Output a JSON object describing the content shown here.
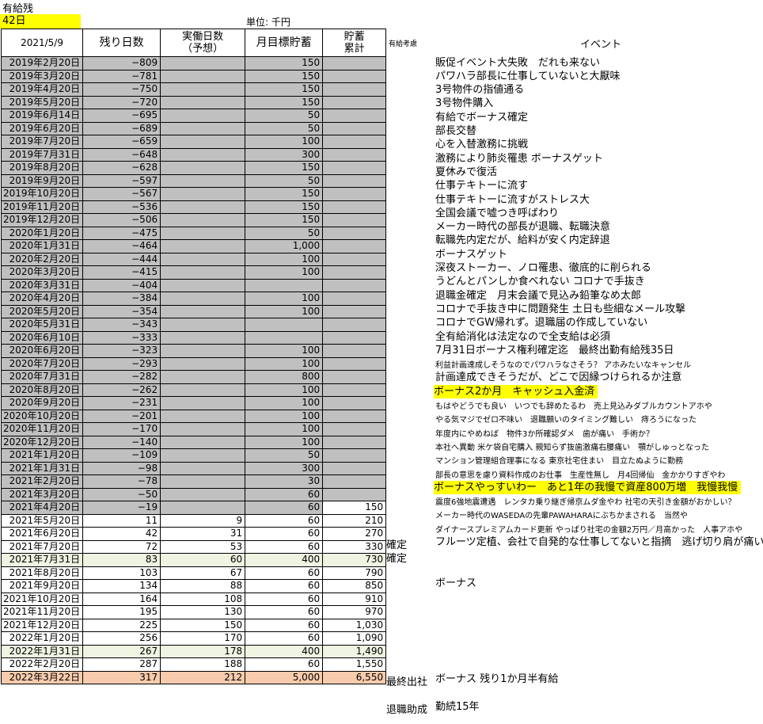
{
  "title": "有給残",
  "remaining_days": "42日",
  "unit_label": "単位: 千円",
  "headers": {
    "date": "2021/5/9",
    "remaining": "残り日数",
    "workdays": "実働日数\n（予想）",
    "target": "月目標貯蓄",
    "cumulative": "貯蓄\n累計",
    "notes": "有給考慮",
    "event": "イベント"
  },
  "rows": [
    {
      "date": "2019年2月20日",
      "remaining": "−809",
      "workdays": "",
      "target": "150",
      "cumulative": "",
      "note": "",
      "event": "販促イベント大失敗　だれも来ない",
      "style": "past",
      "small": false
    },
    {
      "date": "2019年3月20日",
      "remaining": "−781",
      "workdays": "",
      "target": "150",
      "cumulative": "",
      "note": "",
      "event": "パワハラ部長に仕事していないと大厭味",
      "style": "past",
      "small": false
    },
    {
      "date": "2019年4月20日",
      "remaining": "−750",
      "workdays": "",
      "target": "150",
      "cumulative": "",
      "note": "",
      "event": "3号物件の指値通る",
      "style": "past",
      "small": false
    },
    {
      "date": "2019年5月20日",
      "remaining": "−720",
      "workdays": "",
      "target": "150",
      "cumulative": "",
      "note": "",
      "event": "3号物件購入",
      "style": "past",
      "small": false
    },
    {
      "date": "2019年6月14日",
      "remaining": "−695",
      "workdays": "",
      "target": "50",
      "cumulative": "",
      "note": "",
      "event": "有給でボーナス確定",
      "style": "past",
      "small": false
    },
    {
      "date": "2019年6月20日",
      "remaining": "−689",
      "workdays": "",
      "target": "50",
      "cumulative": "",
      "note": "",
      "event": "部長交替",
      "style": "past",
      "small": false
    },
    {
      "date": "2019年7月20日",
      "remaining": "−659",
      "workdays": "",
      "target": "100",
      "cumulative": "",
      "note": "",
      "event": "心を入替激務に挑戦",
      "style": "past",
      "small": false
    },
    {
      "date": "2019年7月31日",
      "remaining": "−648",
      "workdays": "",
      "target": "300",
      "cumulative": "",
      "note": "",
      "event": "激務により肺炎罹患 ボーナスゲット",
      "style": "past",
      "small": false
    },
    {
      "date": "2019年8月20日",
      "remaining": "−628",
      "workdays": "",
      "target": "150",
      "cumulative": "",
      "note": "",
      "event": "夏休みで復活",
      "style": "past",
      "small": false
    },
    {
      "date": "2019年9月20日",
      "remaining": "−597",
      "workdays": "",
      "target": "50",
      "cumulative": "",
      "note": "",
      "event": "仕事テキトーに流す",
      "style": "past",
      "small": false
    },
    {
      "date": "2019年10月20日",
      "remaining": "−567",
      "workdays": "",
      "target": "150",
      "cumulative": "",
      "note": "",
      "event": "仕事テキトーに流すがストレス大",
      "style": "past",
      "small": false
    },
    {
      "date": "2019年11月20日",
      "remaining": "−536",
      "workdays": "",
      "target": "150",
      "cumulative": "",
      "note": "",
      "event": "全国会議で嘘つき呼ばわり",
      "style": "past",
      "small": false
    },
    {
      "date": "2019年12月20日",
      "remaining": "−506",
      "workdays": "",
      "target": "150",
      "cumulative": "",
      "note": "",
      "event": "メーカー時代の部長が退職、転職決意",
      "style": "past",
      "small": false
    },
    {
      "date": "2020年1月20日",
      "remaining": "−475",
      "workdays": "",
      "target": "50",
      "cumulative": "",
      "note": "",
      "event": "転職先内定だが、給料が安く内定辞退",
      "style": "past",
      "small": false
    },
    {
      "date": "2020年1月31日",
      "remaining": "−464",
      "workdays": "",
      "target": "1,000",
      "cumulative": "",
      "note": "",
      "event": "ボーナスゲット",
      "style": "past",
      "small": false
    },
    {
      "date": "2020年2月20日",
      "remaining": "−444",
      "workdays": "",
      "target": "100",
      "cumulative": "",
      "note": "",
      "event": "深夜ストーカー、ノロ罹患、徹底的に削られる",
      "style": "past",
      "small": false
    },
    {
      "date": "2020年3月20日",
      "remaining": "−415",
      "workdays": "",
      "target": "100",
      "cumulative": "",
      "note": "",
      "event": "うどんとパンしか食べれない コロナで手抜き",
      "style": "past",
      "small": false
    },
    {
      "date": "2020年3月31日",
      "remaining": "−404",
      "workdays": "",
      "target": "",
      "cumulative": "",
      "note": "",
      "event": "退職金確定　月末会議で見込み鉛筆なめ太郎",
      "style": "past",
      "small": false
    },
    {
      "date": "2020年4月20日",
      "remaining": "−384",
      "workdays": "",
      "target": "100",
      "cumulative": "",
      "note": "",
      "event": "コロナで手抜き中に問題発生 土日も些細なメール攻撃",
      "style": "past",
      "small": false
    },
    {
      "date": "2020年5月20日",
      "remaining": "−354",
      "workdays": "",
      "target": "100",
      "cumulative": "",
      "note": "",
      "event": "コロナでGW帰れず。退職届の作成していない",
      "style": "past",
      "small": false
    },
    {
      "date": "2020年5月31日",
      "remaining": "−343",
      "workdays": "",
      "target": "",
      "cumulative": "",
      "note": "",
      "event": "全有給消化は法定なので全支給は必須",
      "style": "past",
      "small": false
    },
    {
      "date": "2020年6月10日",
      "remaining": "−333",
      "workdays": "",
      "target": "",
      "cumulative": "",
      "note": "",
      "event": "7月31日ボーナス権利確定迄　最終出勤有給残35日",
      "style": "past",
      "small": false
    },
    {
      "date": "2020年6月20日",
      "remaining": "−323",
      "workdays": "",
      "target": "100",
      "cumulative": "",
      "note": "",
      "event": "利益計画達成しそうなのでパワハラなさそう？ アホみたいなキャンセル",
      "style": "past",
      "small": true
    },
    {
      "date": "2020年7月20日",
      "remaining": "−293",
      "workdays": "",
      "target": "100",
      "cumulative": "",
      "note": "",
      "event": "計画達成できそうだが、どこで因縁つけられるか注意",
      "style": "past",
      "small": false
    },
    {
      "date": "2020年7月31日",
      "remaining": "−282",
      "workdays": "",
      "target": "800",
      "cumulative": "",
      "note": "",
      "event": "ボーナス2か月　キャッシュ入金済",
      "style": "past",
      "small": false,
      "highlight": true
    },
    {
      "date": "2020年8月20日",
      "remaining": "−262",
      "workdays": "",
      "target": "100",
      "cumulative": "",
      "note": "",
      "event": "もはやどうでも良い　いつでも辞めたるわ　売上見込みダブルカウントアホや",
      "style": "past",
      "small": true
    },
    {
      "date": "2020年9月20日",
      "remaining": "−231",
      "workdays": "",
      "target": "100",
      "cumulative": "",
      "note": "",
      "event": "やる気マジでゼロ不味い　退職願いのタイミング難しい　痔ろうになった",
      "style": "past",
      "small": true
    },
    {
      "date": "2020年10月20日",
      "remaining": "−201",
      "workdays": "",
      "target": "100",
      "cumulative": "",
      "note": "",
      "event": "年度内にやめねば　物件3か所確認ダメ　歯が痛い　手術か？",
      "style": "past",
      "small": true
    },
    {
      "date": "2020年11月20日",
      "remaining": "−170",
      "workdays": "",
      "target": "100",
      "cumulative": "",
      "note": "",
      "event": "本社へ異動 米ケ袋自宅購入 親知らず抜歯激痛右腰痛い　顎がしゅっとなった",
      "style": "past",
      "small": true
    },
    {
      "date": "2020年12月20日",
      "remaining": "−140",
      "workdays": "",
      "target": "100",
      "cumulative": "",
      "note": "",
      "event": "マンション管理組合理事になる 東京社宅住まい　目立たぬように勤務",
      "style": "past",
      "small": true
    },
    {
      "date": "2021年1月20日",
      "remaining": "−109",
      "workdays": "",
      "target": "50",
      "cumulative": "",
      "note": "",
      "event": "部長の意思を慮り資料作成のお仕事　生産性無し　月4回帰仙　金かかりすぎやわ",
      "style": "past",
      "small": true
    },
    {
      "date": "2021年1月31日",
      "remaining": "−98",
      "workdays": "",
      "target": "300",
      "cumulative": "",
      "note": "",
      "event": "ボーナスやっすいわー　あと1年の我慢で資産800万増　我慢我慢",
      "style": "past",
      "small": false,
      "highlight": true
    },
    {
      "date": "2021年2月20日",
      "remaining": "−78",
      "workdays": "",
      "target": "30",
      "cumulative": "",
      "note": "",
      "event": "震度6強地震遭遇　レンタカ乗り継ぎ帰京ムダ金やわ 社宅の天引き金額がおかしい？",
      "style": "past",
      "small": true
    },
    {
      "date": "2021年3月20日",
      "remaining": "−50",
      "workdays": "",
      "target": "60",
      "cumulative": "",
      "note": "",
      "event": "メーカー時代のWASEDAの先輩PAWAHARAにぶちかまされる　当然や",
      "style": "past",
      "small": true
    },
    {
      "date": "2021年4月20日",
      "remaining": "−19",
      "workdays": "",
      "target": "60",
      "cumulative": "150",
      "note": "",
      "event": "ダイナースプレミアムカード更新 やっぱり社宅の金額2万円／月高かった　人事アホや",
      "style": "past",
      "small": true
    },
    {
      "date": "2021年5月20日",
      "remaining": "11",
      "workdays": "9",
      "target": "60",
      "cumulative": "210",
      "note": "確定",
      "event": "フルーツ定植、会社で自発的な仕事してないと指摘　逃げ切り肩が痛い",
      "style": "future",
      "small": false
    },
    {
      "date": "2021年6月20日",
      "remaining": "42",
      "workdays": "31",
      "target": "60",
      "cumulative": "270",
      "note": "確定",
      "event": "",
      "style": "future",
      "small": false
    },
    {
      "date": "2021年7月20日",
      "remaining": "72",
      "workdays": "53",
      "target": "60",
      "cumulative": "330",
      "note": "",
      "event": "",
      "style": "future",
      "small": false
    },
    {
      "date": "2021年7月31日",
      "remaining": "83",
      "workdays": "60",
      "target": "400",
      "cumulative": "730",
      "note": "",
      "event": "ボーナス",
      "style": "green",
      "small": false
    },
    {
      "date": "2021年8月20日",
      "remaining": "103",
      "workdays": "67",
      "target": "60",
      "cumulative": "790",
      "note": "",
      "event": "",
      "style": "future",
      "small": false
    },
    {
      "date": "2021年9月20日",
      "remaining": "134",
      "workdays": "88",
      "target": "60",
      "cumulative": "850",
      "note": "",
      "event": "",
      "style": "future",
      "small": false
    },
    {
      "date": "2021年10月20日",
      "remaining": "164",
      "workdays": "108",
      "target": "60",
      "cumulative": "910",
      "note": "",
      "event": "",
      "style": "future",
      "small": false
    },
    {
      "date": "2021年11月20日",
      "remaining": "195",
      "workdays": "130",
      "target": "60",
      "cumulative": "970",
      "note": "",
      "event": "",
      "style": "future",
      "small": false
    },
    {
      "date": "2021年12月20日",
      "remaining": "225",
      "workdays": "150",
      "target": "60",
      "cumulative": "1,030",
      "note": "",
      "event": "",
      "style": "future",
      "small": false
    },
    {
      "date": "2022年1月20日",
      "remaining": "256",
      "workdays": "170",
      "target": "60",
      "cumulative": "1,090",
      "note": "",
      "event": "",
      "style": "future",
      "small": false
    },
    {
      "date": "2022年1月31日",
      "remaining": "267",
      "workdays": "178",
      "target": "400",
      "cumulative": "1,490",
      "note": "最終出社",
      "event": "ボーナス 残り1か月半有給",
      "style": "green",
      "small": false
    },
    {
      "date": "2022年2月20日",
      "remaining": "287",
      "workdays": "188",
      "target": "60",
      "cumulative": "1,550",
      "note": "",
      "event": "",
      "style": "future",
      "small": false
    },
    {
      "date": "2022年3月22日",
      "remaining": "317",
      "workdays": "212",
      "target": "5,000",
      "cumulative": "6,550",
      "note": "退職助成",
      "event": "勤続15年",
      "style": "orange",
      "small": false
    }
  ],
  "colors": {
    "gray": "#c0c0c0",
    "yellow": "#ffff00",
    "green": "#eef3e2",
    "orange": "#f8cbad"
  }
}
